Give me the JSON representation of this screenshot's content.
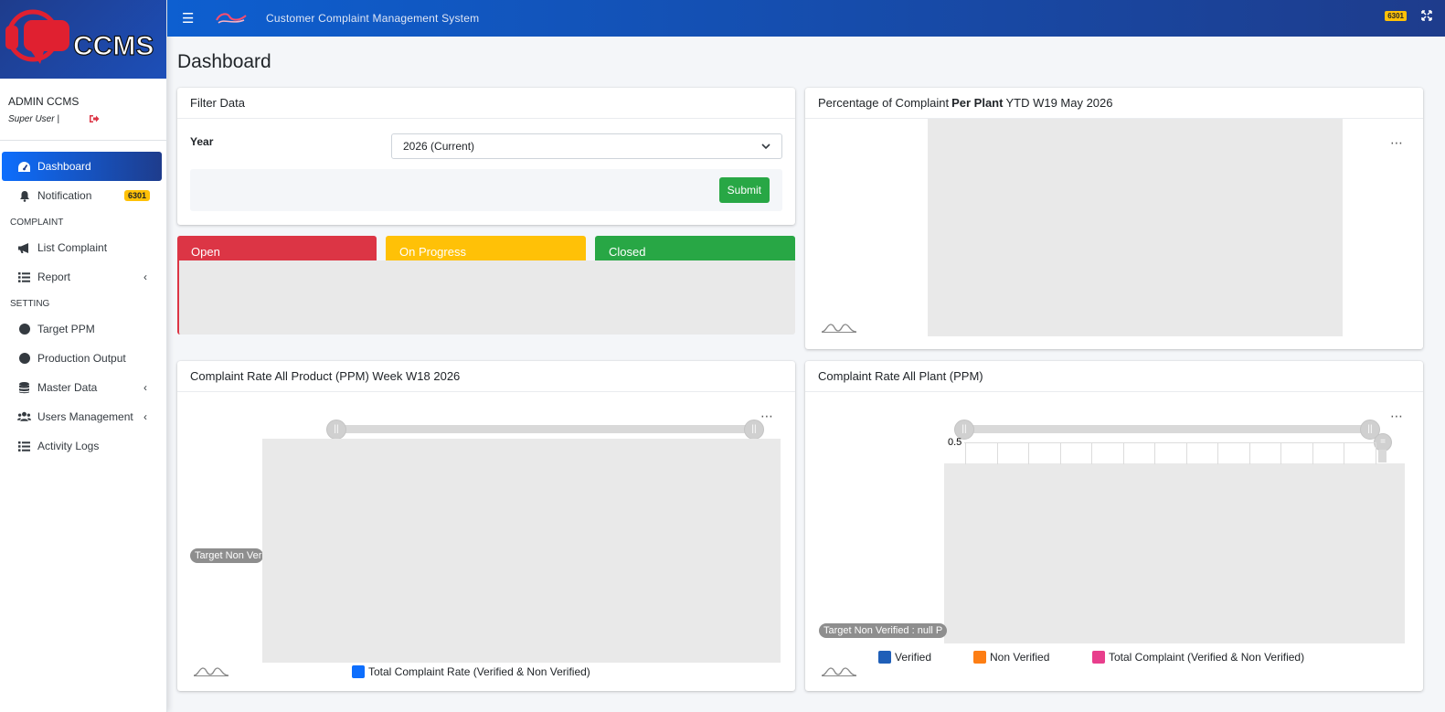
{
  "app": {
    "logo_text": "CCMS",
    "title": "Customer Complaint Management System",
    "top_badge": "6301"
  },
  "user": {
    "name": "ADMIN CCMS",
    "role": "Super User |"
  },
  "sidebar": {
    "items": [
      {
        "label": "Dashboard",
        "icon": "tachometer-icon",
        "active": true
      },
      {
        "label": "Notification",
        "icon": "bell-icon",
        "badge": "6301"
      },
      {
        "header": "COMPLAINT"
      },
      {
        "label": "List Complaint",
        "icon": "megaphone-icon"
      },
      {
        "label": "Report",
        "icon": "list-icon",
        "chevron": true
      },
      {
        "header": "SETTING"
      },
      {
        "label": "Target PPM",
        "icon": "circle-icon"
      },
      {
        "label": "Production Output",
        "icon": "circle-icon"
      },
      {
        "label": "Master Data",
        "icon": "database-icon",
        "chevron": true
      },
      {
        "label": "Users Management",
        "icon": "users-icon",
        "chevron": true
      },
      {
        "label": "Activity Logs",
        "icon": "list-icon"
      }
    ]
  },
  "page": {
    "title": "Dashboard"
  },
  "filter": {
    "header": "Filter Data",
    "year_label": "Year",
    "year_value": "2026 (Current)",
    "submit_label": "Submit"
  },
  "status_tabs": {
    "open": "Open",
    "progress": "On Progress",
    "closed": "Closed"
  },
  "colors": {
    "open": "#dc3545",
    "progress": "#ffc107",
    "closed": "#28a745",
    "verified": "#1f5fb8",
    "non_verified": "#fd7e14",
    "total": "#e83e8c",
    "total_rate": "#0d6efd"
  },
  "plant_pct": {
    "title_pre": "Percentage of Complaint",
    "title_bold": "Per Plant",
    "title_post": "YTD W19 May 2026"
  },
  "rate_product": {
    "title": "Complaint Rate All Product (PPM) Week W18 2026",
    "target_label": "Target Non Verif",
    "legend": "Total Complaint Rate (Verified & Non Verified)"
  },
  "rate_plant": {
    "title": "Complaint Rate All Plant (PPM)",
    "y_tick": "0.5",
    "target_label": "Target Non Verified : null P",
    "legend": [
      "Verified",
      "Non Verified",
      "Total Complaint (Verified & Non Verified)"
    ]
  }
}
